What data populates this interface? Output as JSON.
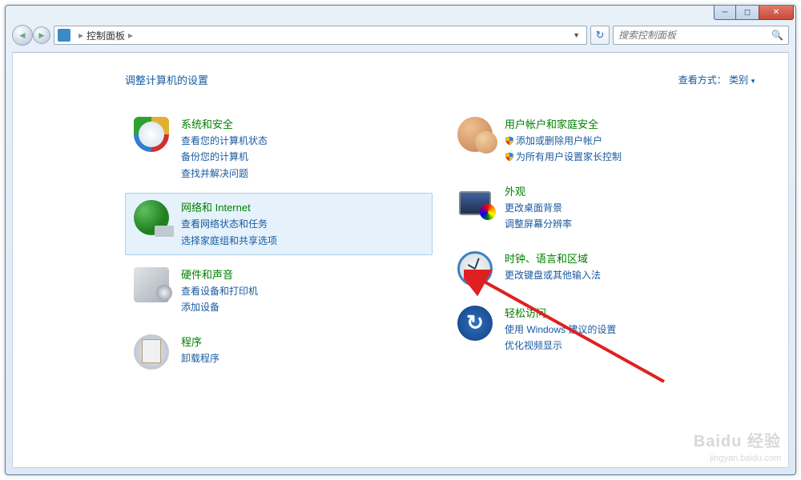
{
  "window": {
    "breadcrumb_root": "控制面板"
  },
  "search": {
    "placeholder": "搜索控制面板"
  },
  "page": {
    "title": "调整计算机的设置",
    "view_label": "查看方式：",
    "view_value": "类别"
  },
  "left": [
    {
      "title": "系统和安全",
      "links": [
        "查看您的计算机状态",
        "备份您的计算机",
        "查找并解决问题"
      ],
      "icon": "security",
      "selected": false
    },
    {
      "title": "网络和 Internet",
      "links": [
        "查看网络状态和任务",
        "选择家庭组和共享选项"
      ],
      "icon": "network",
      "selected": true
    },
    {
      "title": "硬件和声音",
      "links": [
        "查看设备和打印机",
        "添加设备"
      ],
      "icon": "hardware",
      "selected": false
    },
    {
      "title": "程序",
      "links": [
        "卸载程序"
      ],
      "icon": "programs",
      "selected": false
    }
  ],
  "right": [
    {
      "title": "用户帐户和家庭安全",
      "links": [
        "添加或删除用户帐户",
        "为所有用户设置家长控制"
      ],
      "shields": [
        true,
        true
      ],
      "icon": "users"
    },
    {
      "title": "外观",
      "links": [
        "更改桌面背景",
        "调整屏幕分辨率"
      ],
      "icon": "appearance"
    },
    {
      "title": "时钟、语言和区域",
      "links": [
        "更改键盘或其他输入法"
      ],
      "icon": "clock"
    },
    {
      "title": "轻松访问",
      "links": [
        "使用 Windows 建议的设置",
        "优化视频显示"
      ],
      "icon": "ease"
    }
  ],
  "watermark": {
    "brand": "Baidu 经验",
    "url": "jingyan.baidu.com"
  }
}
